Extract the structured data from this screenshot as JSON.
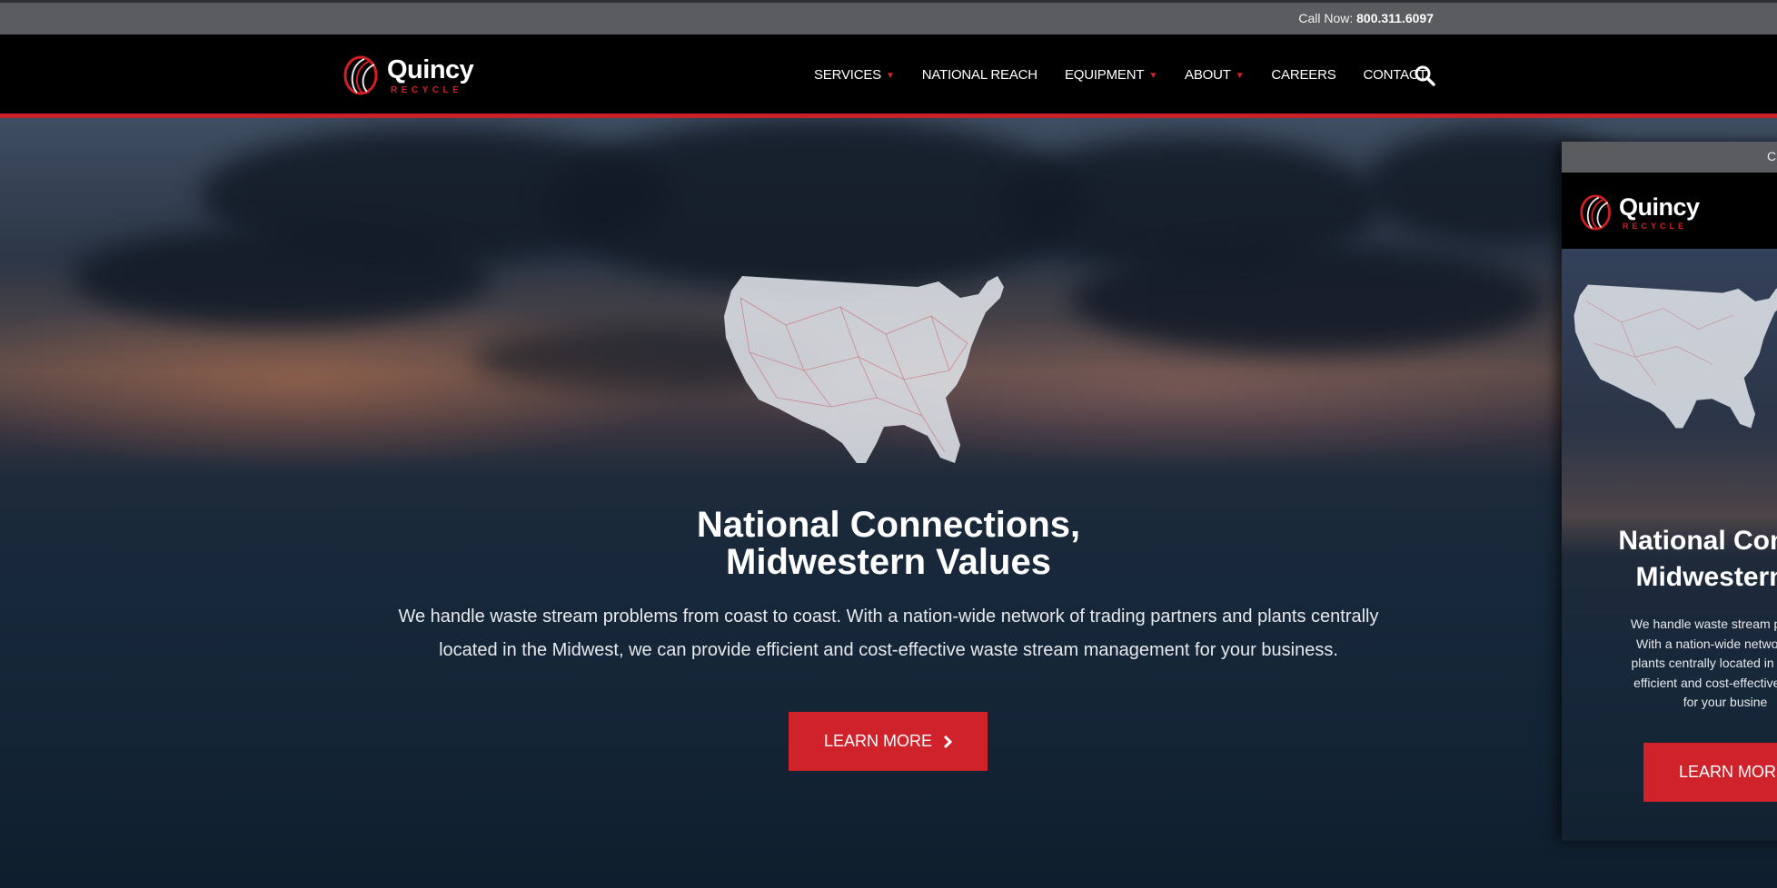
{
  "topbar": {
    "call_label": "Call Now:",
    "phone": "800.311.6097"
  },
  "brand": {
    "name": "Quincy",
    "tagline": "RECYCLE",
    "accent": "#c92127"
  },
  "nav": {
    "items": [
      {
        "label": "SERVICES",
        "dropdown": true
      },
      {
        "label": "NATIONAL REACH",
        "dropdown": false
      },
      {
        "label": "EQUIPMENT",
        "dropdown": true
      },
      {
        "label": "ABOUT",
        "dropdown": true
      },
      {
        "label": "CAREERS",
        "dropdown": false
      },
      {
        "label": "CONTACT",
        "dropdown": false
      }
    ],
    "search_icon": "search-icon"
  },
  "hero": {
    "title_line1": "National Connections,",
    "title_line2": "Midwestern Values",
    "text_line1": "We handle waste stream problems from coast to coast. With a nation-wide network of trading partners and plants centrally",
    "text_line2": "located in the Midwest, we can provide efficient and cost-effective waste stream management for your business.",
    "button_label": "LEARN MORE",
    "button_color": "#d0222a"
  },
  "preview": {
    "topbar_text": "C",
    "title_line1": "National Conn",
    "title_line2": "Midwestern",
    "text_lines": [
      "We handle waste stream problem",
      "With a nation-wide network of tr",
      "plants centrally located in the Mid",
      "efficient and cost-effective waste",
      "for your busine"
    ],
    "button_label": "LEARN MORE"
  }
}
